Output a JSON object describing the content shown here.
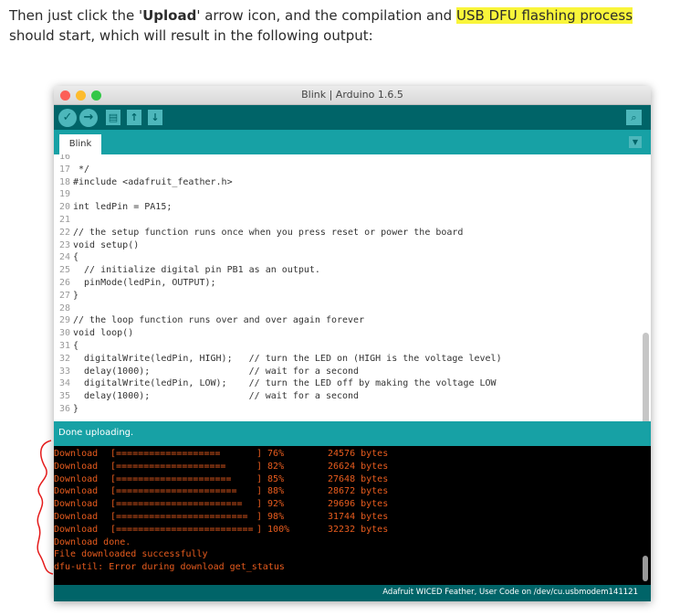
{
  "intro": {
    "part1": "Then just click the '",
    "bold": "Upload",
    "part2": "' arrow icon, and the compilation and ",
    "highlight": "USB DFU flashing process",
    "part3": " should start, which will result in the following output:"
  },
  "window": {
    "title": "Blink | Arduino 1.6.5",
    "toolbar": {
      "verify_icon": "check-icon",
      "upload_icon": "arrow-right-icon",
      "new_icon": "page-icon",
      "open_icon": "arrow-up-icon",
      "save_icon": "arrow-down-icon",
      "serial_icon": "magnifier-icon"
    },
    "tab": "Blink",
    "code": [
      {
        "n": "16",
        "t": ""
      },
      {
        "n": "17",
        "t": " */"
      },
      {
        "n": "18",
        "t": "#include <adafruit_feather.h>"
      },
      {
        "n": "19",
        "t": ""
      },
      {
        "n": "20",
        "t": "int ledPin = PA15;"
      },
      {
        "n": "21",
        "t": ""
      },
      {
        "n": "22",
        "t": "// the setup function runs once when you press reset or power the board"
      },
      {
        "n": "23",
        "t": "void setup()"
      },
      {
        "n": "24",
        "t": "{"
      },
      {
        "n": "25",
        "t": "  // initialize digital pin PB1 as an output."
      },
      {
        "n": "26",
        "t": "  pinMode(ledPin, OUTPUT);"
      },
      {
        "n": "27",
        "t": "}"
      },
      {
        "n": "28",
        "t": ""
      },
      {
        "n": "29",
        "t": "// the loop function runs over and over again forever"
      },
      {
        "n": "30",
        "t": "void loop()"
      },
      {
        "n": "31",
        "t": "{"
      },
      {
        "n": "32",
        "t": "  digitalWrite(ledPin, HIGH);   // turn the LED on (HIGH is the voltage level)"
      },
      {
        "n": "33",
        "t": "  delay(1000);                  // wait for a second"
      },
      {
        "n": "34",
        "t": "  digitalWrite(ledPin, LOW);    // turn the LED off by making the voltage LOW"
      },
      {
        "n": "35",
        "t": "  delay(1000);                  // wait for a second"
      },
      {
        "n": "36",
        "t": "}"
      }
    ],
    "status": "Done uploading.",
    "console": {
      "downloads": [
        {
          "label": "Download",
          "bar": "[===================",
          "pct": "] 76%",
          "bytes": "24576 bytes"
        },
        {
          "label": "Download",
          "bar": "[====================",
          "pct": "] 82%",
          "bytes": "26624 bytes"
        },
        {
          "label": "Download",
          "bar": "[=====================",
          "pct": "] 85%",
          "bytes": "27648 bytes"
        },
        {
          "label": "Download",
          "bar": "[======================",
          "pct": "] 88%",
          "bytes": "28672 bytes"
        },
        {
          "label": "Download",
          "bar": "[=======================",
          "pct": "] 92%",
          "bytes": "29696 bytes"
        },
        {
          "label": "Download",
          "bar": "[========================",
          "pct": "] 98%",
          "bytes": "31744 bytes"
        },
        {
          "label": "Download",
          "bar": "[=========================",
          "pct": "] 100%",
          "bytes": "32232 bytes"
        }
      ],
      "done": "Download done.",
      "success": "File downloaded successfully",
      "error": "dfu-util: Error during download get_status"
    },
    "footer": "Adafruit WICED Feather, User Code on /dev/cu.usbmodem141121"
  }
}
